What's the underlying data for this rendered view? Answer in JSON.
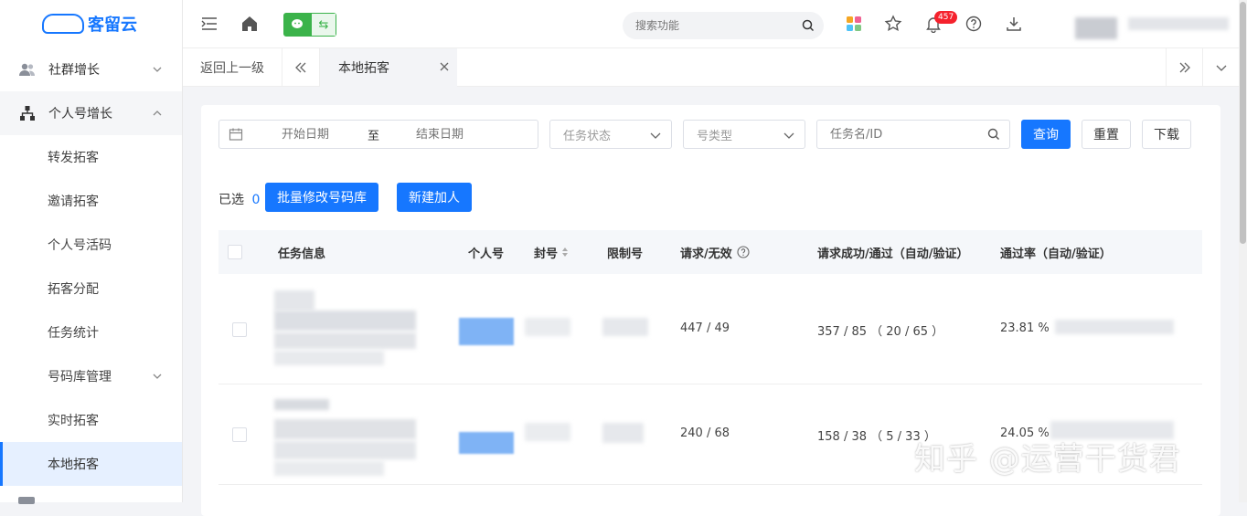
{
  "app": {
    "logo_text": "客留云",
    "brand_color": "#1677ff"
  },
  "sidebar": {
    "groups": [
      {
        "label": "社群增长",
        "icon": "users-icon",
        "expanded": false
      },
      {
        "label": "个人号增长",
        "icon": "org-tree-icon",
        "expanded": true
      }
    ],
    "items": [
      {
        "label": "转发拓客"
      },
      {
        "label": "邀请拓客"
      },
      {
        "label": "个人号活码"
      },
      {
        "label": "拓客分配"
      },
      {
        "label": "任务统计"
      },
      {
        "label": "号码库管理",
        "has_submenu": true
      },
      {
        "label": "实时拓客"
      },
      {
        "label": "本地拓客",
        "active": true
      }
    ]
  },
  "topbar": {
    "search_placeholder": "搜索功能",
    "notification_count": "457",
    "icons": [
      "menu-fold-icon",
      "home-icon",
      "wechat-icon",
      "switch-icon",
      "search-icon",
      "apps-icon",
      "star-icon",
      "bell-icon",
      "help-icon",
      "download-icon"
    ]
  },
  "tabs": {
    "back_label": "返回上一级",
    "current_label": "本地拓客"
  },
  "filters": {
    "start_placeholder": "开始日期",
    "range_sep": "至",
    "end_placeholder": "结束日期",
    "status_placeholder": "任务状态",
    "type_placeholder": "号类型",
    "task_placeholder": "任务名/ID",
    "query_label": "查询",
    "reset_label": "重置",
    "download_label": "下载"
  },
  "actions": {
    "selected_label": "已选",
    "selected_count": "0",
    "batch_label": "批量修改号码库",
    "new_label": "新建加人"
  },
  "table": {
    "columns": [
      "任务信息",
      "个人号",
      "封号",
      "限制号",
      "请求/无效",
      "请求成功/通过（自动/验证）",
      "通过率（自动/验证）"
    ],
    "rows": [
      {
        "requests": "447 / 49",
        "success": "357 / 85 （ 20 / 65 ）",
        "rate": "23.81 %"
      },
      {
        "requests": "240 / 68",
        "success": "158 / 38 （ 5 / 33 ）",
        "rate": "24.05 %"
      }
    ]
  },
  "watermark": "知乎 @运营干货君"
}
